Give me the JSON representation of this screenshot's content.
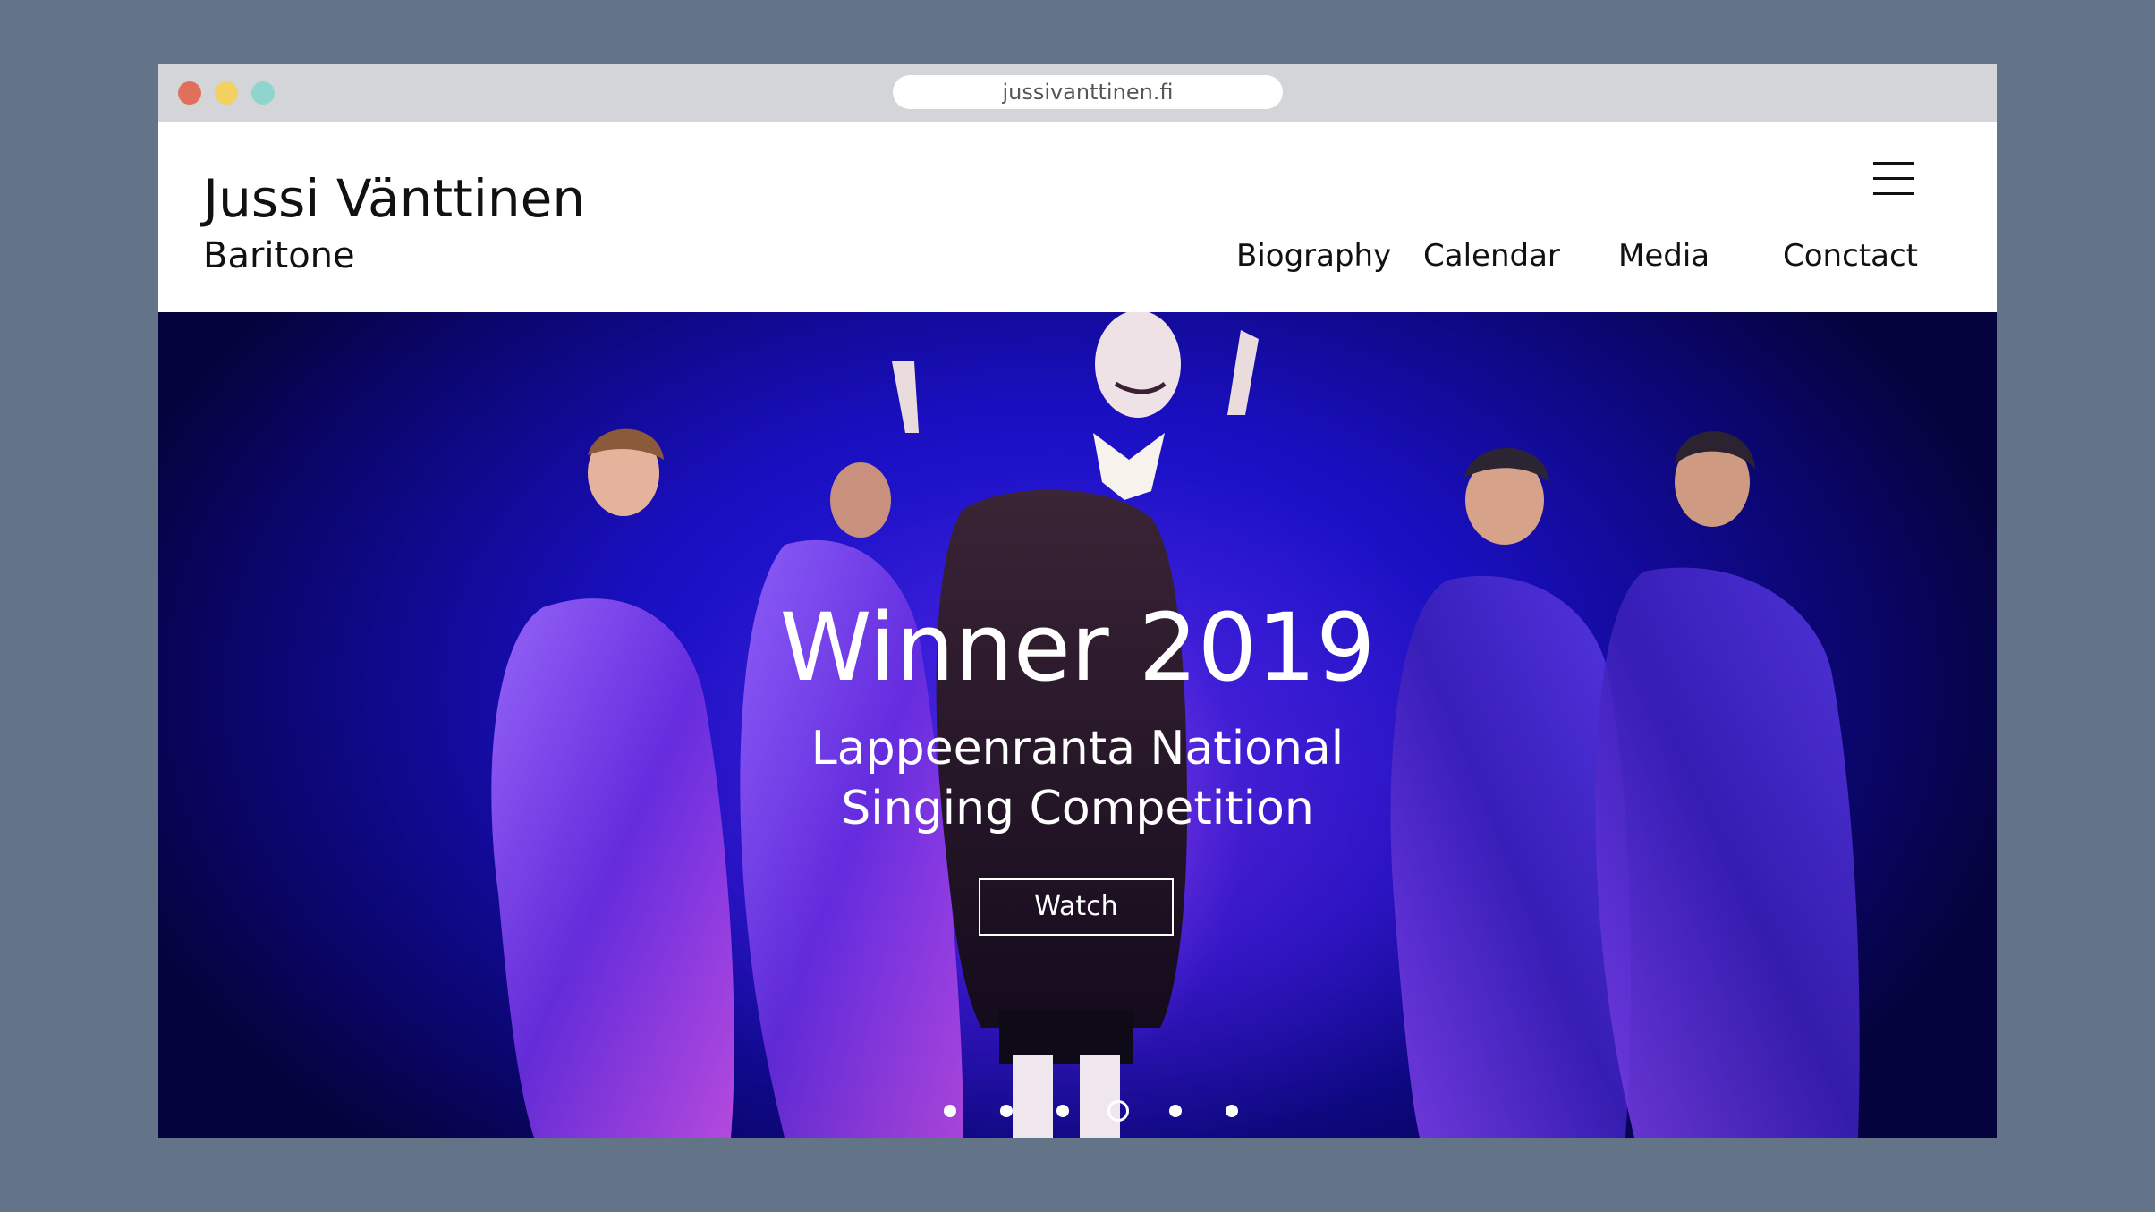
{
  "browser": {
    "url": "jussivanttinen.fi"
  },
  "site": {
    "name": "Jussi Vänttinen",
    "subtitle": "Baritone"
  },
  "nav": {
    "items": [
      {
        "label": "Biography"
      },
      {
        "label": "Calendar"
      },
      {
        "label": "Media"
      },
      {
        "label": "Conctact"
      }
    ]
  },
  "hero": {
    "title": "Winner 2019",
    "subtitle_line1": "Lappeenranta National",
    "subtitle_line2": "Singing Competition",
    "button_label": "Watch",
    "slide_count": 6,
    "active_slide": 4
  },
  "colors": {
    "backdrop": "#637488",
    "chrome": "#d4d5d8",
    "hero_blue": "#2b1ee6",
    "traffic_red": "#e0705b",
    "traffic_yellow": "#f3d160",
    "traffic_green": "#8fd4cd"
  },
  "icons": {
    "menu": "hamburger-menu-icon"
  }
}
